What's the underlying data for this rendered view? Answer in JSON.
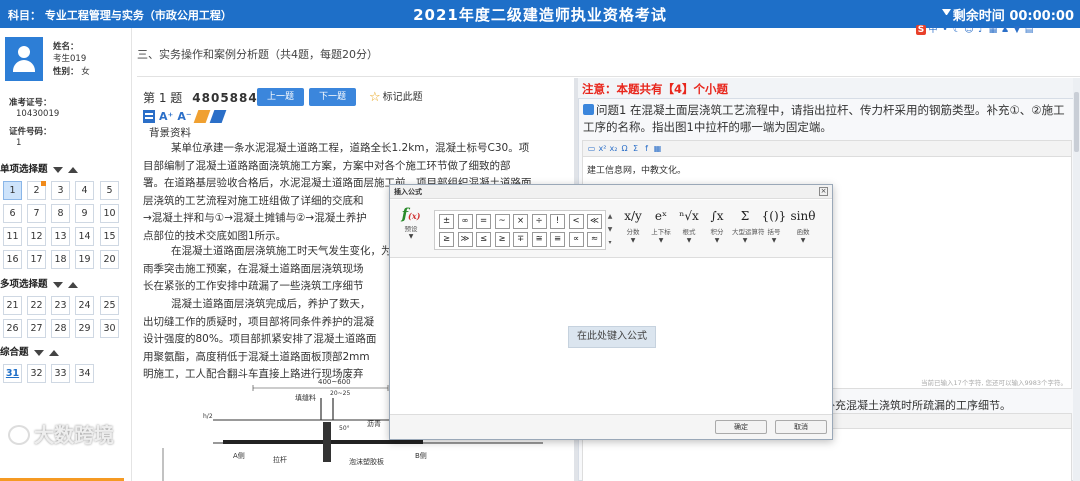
{
  "header": {
    "subject": "科目：  专业工程管理与实务（市政公用工程）",
    "title": "2021年度二级建造师执业资格考试",
    "timer_label": "剩余时间",
    "timer_value": "00:00:00"
  },
  "candidate": {
    "name_label": "姓名：",
    "name": "考生019",
    "gender_label": "性别：",
    "gender": "女",
    "ticket_label": "准考证号：",
    "ticket": "10430019",
    "id_label": "证件号码：",
    "id": "1"
  },
  "sections": [
    {
      "label": "单项选择题",
      "items": [
        "1",
        "2",
        "3",
        "4",
        "5",
        "6",
        "7",
        "8",
        "9",
        "10",
        "11",
        "12",
        "13",
        "14",
        "15",
        "16",
        "17",
        "18",
        "19",
        "20"
      ]
    },
    {
      "label": "多项选择题",
      "items": [
        "21",
        "22",
        "23",
        "24",
        "25",
        "26",
        "27",
        "28",
        "29",
        "30"
      ]
    },
    {
      "label": "综合题",
      "items": [
        "31",
        "32",
        "33",
        "34"
      ]
    }
  ],
  "section_header": "三、实务操作和案例分析题（共4题，每题20分）",
  "question": {
    "number_label": "第 1 题",
    "id": "48058841",
    "prev_label": "上一题",
    "next_label": "下一题",
    "mark_label": "标记此题",
    "bg_title": "背景资料",
    "para1_lines": [
      "某单位承建一条水泥混凝土道路工程，道路全长1.2km，混凝土标号C30。项",
      "目部编制了混凝土道路路面浇筑施工方案，方案中对各个施工环节做了细致的部",
      "署。在道路基层验收合格后，水泥混凝土道路面层施工前，项目部组织混凝土道路面",
      "层浇筑的工艺流程对施工班组做了详细的交底和",
      "→混凝土拌和与①→混凝土摊铺与②→混凝土养护",
      "点部位的技术交底如图1所示。"
    ],
    "para2_lines": [
      "在混凝土道路面层浇筑施工时天气发生变化，为",
      "雨季突击施工预案，在混凝土道路面层浇筑现场",
      "长在紧张的工作安排中疏漏了一些浇筑工序细节"
    ],
    "para3_lines": [
      "混凝土道路面层浇筑完成后，养护了数天，",
      "出切缝工作的质疑时，项目部将同条件养护的混凝",
      "设计强度的80%。项目部抓紧安排了混凝土道路面",
      "用聚氨酯，高度稍低于混凝土道路面板顶部2mm",
      "明施工，工人配合翻斗车直接上路进行现场废弃"
    ],
    "diagram_labels": {
      "top": "400~600",
      "fill": "填缝料",
      "dim": "20~25",
      "a": "A侧",
      "b": "B侧",
      "rod": "拉杆",
      "asphalt": "沥青",
      "foam": "泡沫塑胶板",
      "angle": "50°",
      "hh": "h/2"
    }
  },
  "answer": {
    "notice": "注意：本题共有【4】个小题",
    "q1_text": "问题1  在混凝土面层浇筑工艺流程中，请指出拉杆、传力杆采用的钢筋类型。补充①、②施工工序的名称。指出图1中拉杆的哪一端为固定端。",
    "q1_answer": "建工信息网，中教文化。",
    "counter": "当前已输入17个字符, 您还可以输入9983个字符。",
    "q2_text": "请补充混凝土浇筑时所疏漏的工序细节。"
  },
  "dialog": {
    "title": "插入公式",
    "close": "×",
    "preset_label": "预设",
    "symbols": [
      "±",
      "∞",
      "=",
      "~",
      "×",
      "÷",
      "!",
      "<",
      "≪",
      "≥",
      "≫",
      "≤",
      "≥",
      "∓",
      "≅",
      "≡",
      "∝",
      "≈"
    ],
    "tools": [
      {
        "icon": "x/y",
        "label": "分数"
      },
      {
        "icon": "eˣ",
        "label": "上下标"
      },
      {
        "icon": "ⁿ√x",
        "label": "根式"
      },
      {
        "icon": "∫x",
        "label": "积分"
      },
      {
        "icon": "Σ",
        "label": "大型运算符"
      },
      {
        "icon": "{()}",
        "label": "括号"
      },
      {
        "icon": "sinθ",
        "label": "函数"
      }
    ],
    "placeholder": "在此处键入公式",
    "ok": "确定",
    "cancel": "取消"
  },
  "watermark": "大数跨境",
  "colors": {
    "header": "#1e6fc8",
    "accent": "#3b86dc",
    "notice": "#e8261c",
    "flag": "#f08a1a"
  }
}
